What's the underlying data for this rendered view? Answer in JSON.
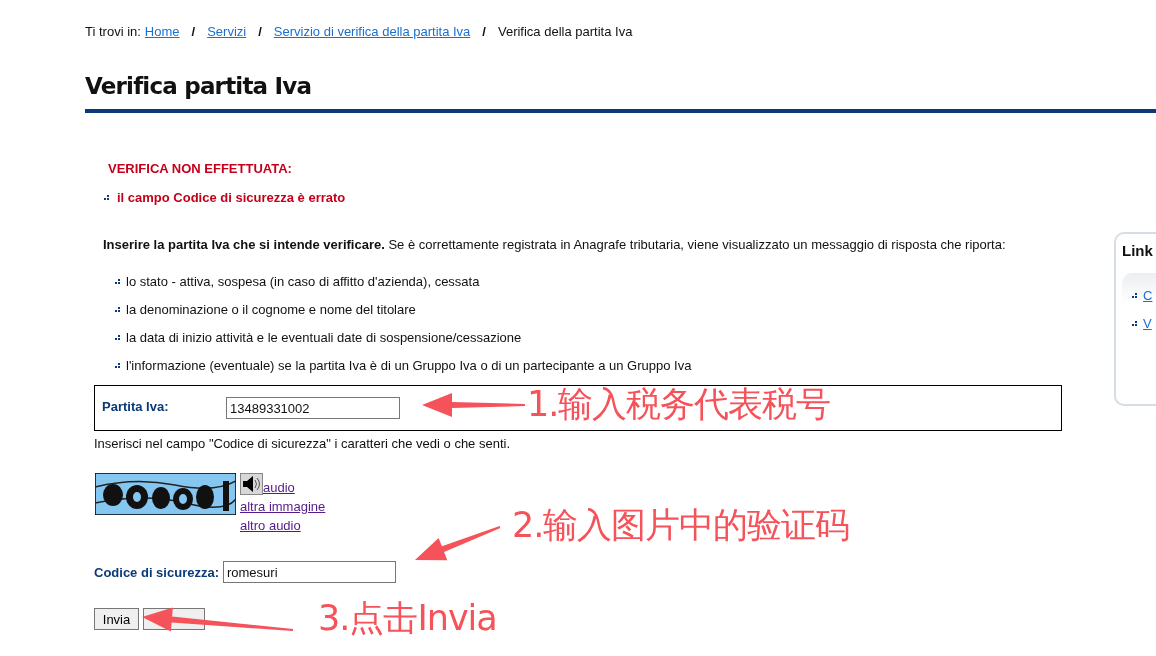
{
  "breadcrumb": {
    "prefix": "Ti trovi in:",
    "items": [
      {
        "label": "Home",
        "link": true
      },
      {
        "label": "Servizi",
        "link": true
      },
      {
        "label": "Servizio di verifica della partita Iva",
        "link": true
      },
      {
        "label": "Verifica della partita Iva",
        "link": false
      }
    ],
    "separator": "/"
  },
  "title": "Verifica partita Iva",
  "error": {
    "heading": "VERIFICA NON EFFETTUATA:",
    "items": [
      "il campo Codice di sicurezza è errato"
    ]
  },
  "intro": "**Inserire la partita Iva che si intende verificare.** Se è correttamente registrata in Anagrafe tributaria, viene visualizzato un messaggio di risposta che riporta:",
  "info_items": [
    "lo stato - attiva, sospesa (in caso di affitto d'azienda), cessata",
    "la denominazione o il cognome e nome del titolare",
    "la data di inizio attività e le eventuali date di sospensione/cessazione",
    "l'informazione (eventuale) se la partita Iva è di un Gruppo Iva o di un partecipante a un Gruppo Iva"
  ],
  "vat_field": {
    "label": "Partita Iva:",
    "value": "13489331002"
  },
  "captcha_hint": "Inserisci nel campo \"Codice di sicurezza\" i caratteri che vedi o che senti.",
  "captcha": {
    "image": {
      "kind": "picture"
    },
    "links": [
      "audio",
      "altra immagine",
      "altro audio"
    ]
  },
  "security_field": {
    "label": "Codice di sicurezza:",
    "value": "romesuri"
  },
  "buttons": [
    {
      "label": "Invia",
      "kind": "labeled"
    },
    {
      "kind": "blank"
    }
  ],
  "side_panel": {
    "title": "Link",
    "links": [
      "C",
      "V"
    ]
  },
  "annotations": [
    {
      "text": "1.输入税务代表税号"
    },
    {
      "text": "2.输入图片中的验证码"
    },
    {
      "text": "3.点击Invia"
    }
  ]
}
